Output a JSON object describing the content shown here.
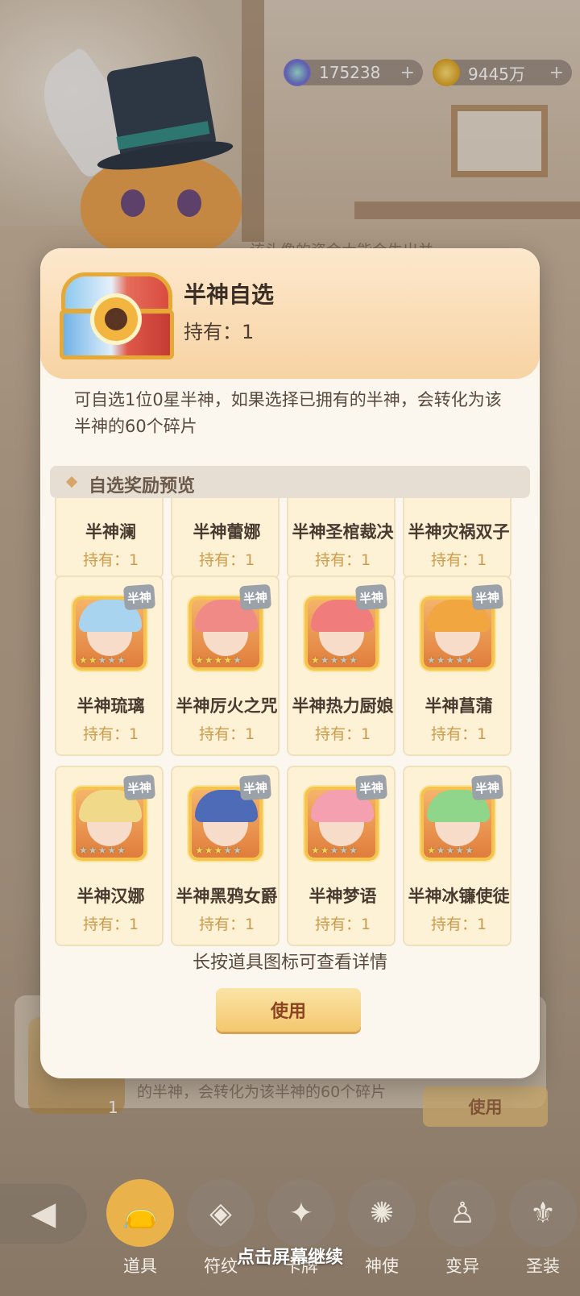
{
  "currencies": [
    {
      "value": "175238",
      "icon": "crystal-icon"
    },
    {
      "value": "9445万",
      "icon": "gold-coin-icon"
    }
  ],
  "background": {
    "text_top": "该头像的资金大能会生出并",
    "text_bottom": "的半神，会转化为该半神的60个碎片",
    "use_label": "使用",
    "count": "1"
  },
  "modal": {
    "title": "半神自选",
    "owned": "持有：1",
    "description": "可自选1位0星半神，如果选择已拥有的半神，会转化为该半神的60个碎片",
    "section_title": "自选奖励预览",
    "badge": "半神",
    "items": [
      {
        "name": "半神澜",
        "owned": "持有：1",
        "stars": 0,
        "hair": "#8db9e6"
      },
      {
        "name": "半神蕾娜",
        "owned": "持有：1",
        "stars": 0,
        "hair": "#e58a8a"
      },
      {
        "name": "半神圣棺裁决",
        "owned": "持有：1",
        "stars": 0,
        "hair": "#d9b36a"
      },
      {
        "name": "半神灾祸双子",
        "owned": "持有：1",
        "stars": 0,
        "hair": "#b57ad9"
      },
      {
        "name": "半神琉璃",
        "owned": "持有：1",
        "stars": 2,
        "hair": "#a9d4f0"
      },
      {
        "name": "半神厉火之咒",
        "owned": "持有：1",
        "stars": 4,
        "hair": "#f08a86"
      },
      {
        "name": "半神热力厨娘",
        "owned": "持有：1",
        "stars": 1,
        "hair": "#f07c7c"
      },
      {
        "name": "半神菖蒲",
        "owned": "持有：1",
        "stars": 0,
        "hair": "#f2a640"
      },
      {
        "name": "半神汉娜",
        "owned": "持有：1",
        "stars": 0,
        "hair": "#f1d98a"
      },
      {
        "name": "半神黑鸦女爵",
        "owned": "持有：1",
        "stars": 3,
        "hair": "#4e6bb8"
      },
      {
        "name": "半神梦语",
        "owned": "持有：1",
        "stars": 2,
        "hair": "#f5a0b0"
      },
      {
        "name": "半神冰镰使徒",
        "owned": "持有：1",
        "stars": 1,
        "hair": "#8fd68a"
      }
    ],
    "hint": "长按道具图标可查看详情",
    "use_button": "使用"
  },
  "nav": {
    "back_icon": "back-arrow-icon",
    "items": [
      {
        "label": "道具",
        "icon": "bag-icon",
        "active": true
      },
      {
        "label": "符纹",
        "icon": "rune-icon",
        "active": false
      },
      {
        "label": "卡牌",
        "icon": "card-icon",
        "active": false
      },
      {
        "label": "神使",
        "icon": "emissary-icon",
        "active": false
      },
      {
        "label": "变异",
        "icon": "mutation-icon",
        "active": false
      },
      {
        "label": "圣装",
        "icon": "armor-icon",
        "active": false
      }
    ]
  },
  "continue_text": "点击屏幕继续"
}
